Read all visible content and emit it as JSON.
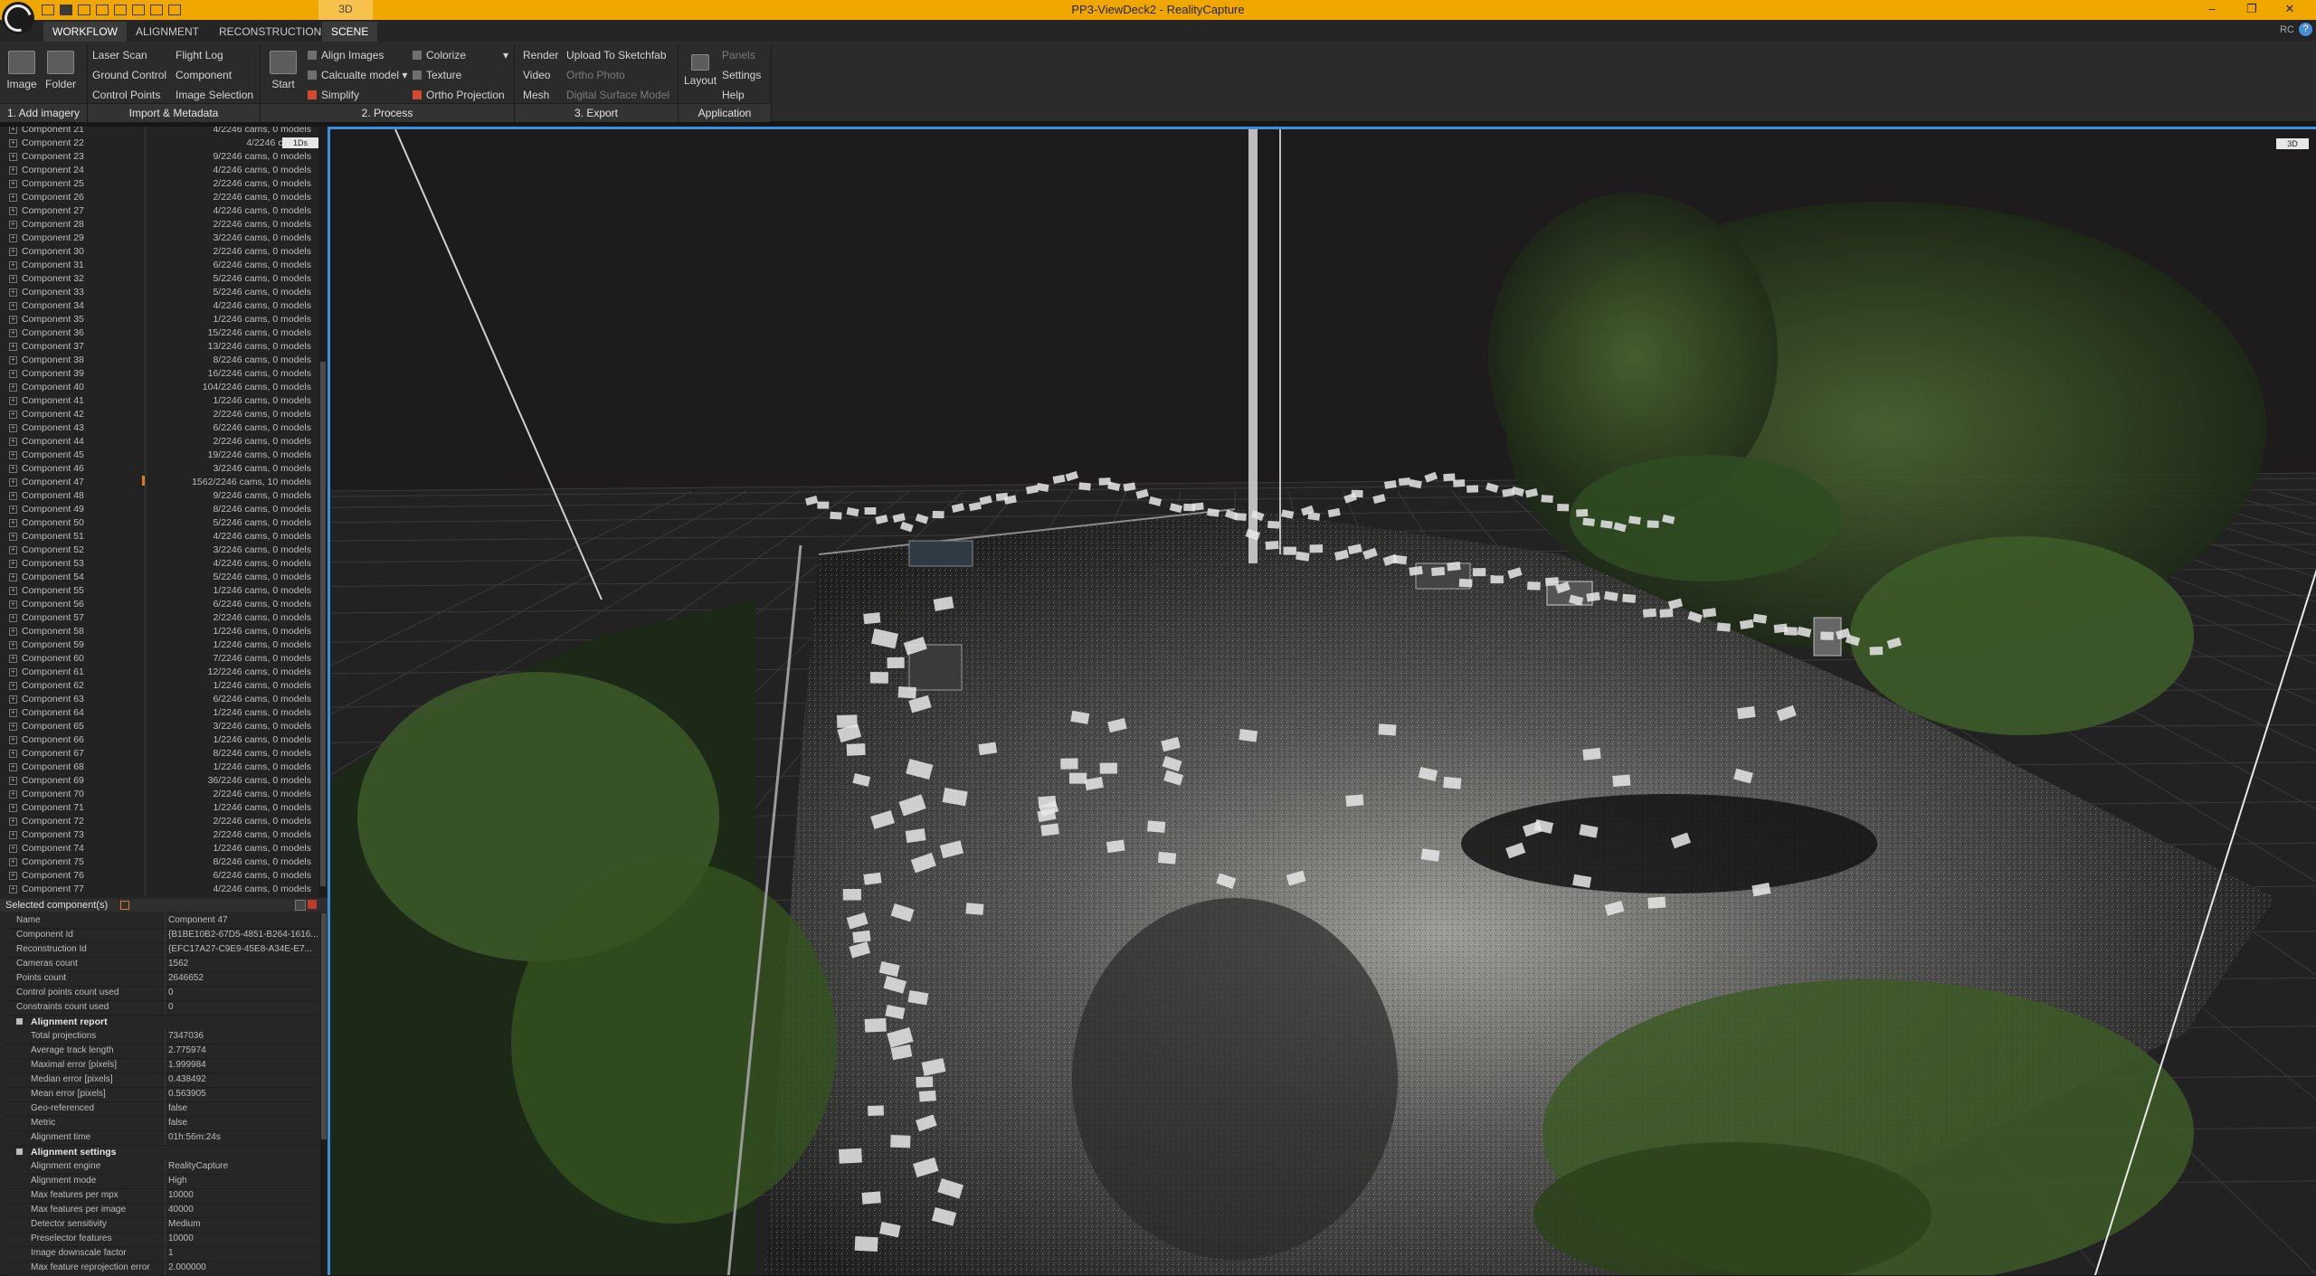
{
  "titlebar": {
    "title": "PP3-ViewDeck2 - RealityCapture",
    "mode_tab": "3D",
    "window_controls": [
      "–",
      "❐",
      "✕"
    ]
  },
  "menu": {
    "tabs": [
      "WORKFLOW",
      "ALIGNMENT",
      "RECONSTRUCTION",
      "SCENE"
    ],
    "active": "WORKFLOW",
    "rc_label": "RC",
    "help_label": "?"
  },
  "ribbon": {
    "add_imagery": {
      "image_label": "Image",
      "folder_label": "Folder",
      "group": "1. Add imagery"
    },
    "import": {
      "laser_scan": "Laser Scan",
      "ground_control": "Ground Control",
      "control_points": "Control Points",
      "flight_log": "Flight Log",
      "component": "Component",
      "image_selection": "Image Selection",
      "group": "Import & Metadata"
    },
    "process": {
      "start": "Start",
      "align_images": "Align Images",
      "calculate_model": "Calcualte model",
      "simplify": "Simplify",
      "colorize": "Colorize",
      "texture": "Texture",
      "ortho_projection": "Ortho Projection",
      "group": "2. Process"
    },
    "export": {
      "render": "Render",
      "video": "Video",
      "mesh": "Mesh",
      "upload": "Upload To Sketchfab",
      "ortho_photo": "Ortho Photo",
      "dsm": "Digital Surface Model",
      "group": "3. Export"
    },
    "application": {
      "layout": "Layout",
      "panels": "Panels",
      "settings": "Settings",
      "help": "Help",
      "group": "Application"
    }
  },
  "components": {
    "badge": "1Ds",
    "rows": [
      {
        "name": "Component 21",
        "status": "4/2246 cams, 0 models"
      },
      {
        "name": "Component 22",
        "status": "4/2246 cams, 0"
      },
      {
        "name": "Component 23",
        "status": "9/2246 cams, 0 models"
      },
      {
        "name": "Component 24",
        "status": "4/2246 cams, 0 models"
      },
      {
        "name": "Component 25",
        "status": "2/2246 cams, 0 models"
      },
      {
        "name": "Component 26",
        "status": "2/2246 cams, 0 models"
      },
      {
        "name": "Component 27",
        "status": "4/2246 cams, 0 models"
      },
      {
        "name": "Component 28",
        "status": "2/2246 cams, 0 models"
      },
      {
        "name": "Component 29",
        "status": "3/2246 cams, 0 models"
      },
      {
        "name": "Component 30",
        "status": "2/2246 cams, 0 models"
      },
      {
        "name": "Component 31",
        "status": "6/2246 cams, 0 models"
      },
      {
        "name": "Component 32",
        "status": "5/2246 cams, 0 models"
      },
      {
        "name": "Component 33",
        "status": "5/2246 cams, 0 models"
      },
      {
        "name": "Component 34",
        "status": "4/2246 cams, 0 models"
      },
      {
        "name": "Component 35",
        "status": "1/2246 cams, 0 models"
      },
      {
        "name": "Component 36",
        "status": "15/2246 cams, 0 models"
      },
      {
        "name": "Component 37",
        "status": "13/2246 cams, 0 models"
      },
      {
        "name": "Component 38",
        "status": "8/2246 cams, 0 models"
      },
      {
        "name": "Component 39",
        "status": "16/2246 cams, 0 models"
      },
      {
        "name": "Component 40",
        "status": "104/2246 cams, 0 models"
      },
      {
        "name": "Component 41",
        "status": "1/2246 cams, 0 models"
      },
      {
        "name": "Component 42",
        "status": "2/2246 cams, 0 models"
      },
      {
        "name": "Component 43",
        "status": "6/2246 cams, 0 models"
      },
      {
        "name": "Component 44",
        "status": "2/2246 cams, 0 models"
      },
      {
        "name": "Component 45",
        "status": "19/2246 cams, 0 models"
      },
      {
        "name": "Component 46",
        "status": "3/2246 cams, 0 models"
      },
      {
        "name": "Component 47",
        "status": "1562/2246 cams, 10 models"
      },
      {
        "name": "Component 48",
        "status": "9/2246 cams, 0 models"
      },
      {
        "name": "Component 49",
        "status": "8/2246 cams, 0 models"
      },
      {
        "name": "Component 50",
        "status": "5/2246 cams, 0 models"
      },
      {
        "name": "Component 51",
        "status": "4/2246 cams, 0 models"
      },
      {
        "name": "Component 52",
        "status": "3/2246 cams, 0 models"
      },
      {
        "name": "Component 53",
        "status": "4/2246 cams, 0 models"
      },
      {
        "name": "Component 54",
        "status": "5/2246 cams, 0 models"
      },
      {
        "name": "Component 55",
        "status": "1/2246 cams, 0 models"
      },
      {
        "name": "Component 56",
        "status": "6/2246 cams, 0 models"
      },
      {
        "name": "Component 57",
        "status": "2/2246 cams, 0 models"
      },
      {
        "name": "Component 58",
        "status": "1/2246 cams, 0 models"
      },
      {
        "name": "Component 59",
        "status": "1/2246 cams, 0 models"
      },
      {
        "name": "Component 60",
        "status": "7/2246 cams, 0 models"
      },
      {
        "name": "Component 61",
        "status": "12/2246 cams, 0 models"
      },
      {
        "name": "Component 62",
        "status": "1/2246 cams, 0 models"
      },
      {
        "name": "Component 63",
        "status": "6/2246 cams, 0 models"
      },
      {
        "name": "Component 64",
        "status": "1/2246 cams, 0 models"
      },
      {
        "name": "Component 65",
        "status": "3/2246 cams, 0 models"
      },
      {
        "name": "Component 66",
        "status": "1/2246 cams, 0 models"
      },
      {
        "name": "Component 67",
        "status": "8/2246 cams, 0 models"
      },
      {
        "name": "Component 68",
        "status": "1/2246 cams, 0 models"
      },
      {
        "name": "Component 69",
        "status": "36/2246 cams, 0 models"
      },
      {
        "name": "Component 70",
        "status": "2/2246 cams, 0 models"
      },
      {
        "name": "Component 71",
        "status": "1/2246 cams, 0 models"
      },
      {
        "name": "Component 72",
        "status": "2/2246 cams, 0 models"
      },
      {
        "name": "Component 73",
        "status": "2/2246 cams, 0 models"
      },
      {
        "name": "Component 74",
        "status": "1/2246 cams, 0 models"
      },
      {
        "name": "Component 75",
        "status": "8/2246 cams, 0 models"
      },
      {
        "name": "Component 76",
        "status": "6/2246 cams, 0 models"
      },
      {
        "name": "Component 77",
        "status": "4/2246 cams, 0 models"
      }
    ]
  },
  "selected": {
    "header": "Selected component(s)",
    "properties": [
      {
        "key": "Name",
        "value": "Component 47"
      },
      {
        "key": "Component Id",
        "value": "{B1BE10B2-67D5-4851-B264-1616..."
      },
      {
        "key": "Reconstruction Id",
        "value": "{EFC17A27-C9E9-45E8-A34E-E7..."
      },
      {
        "key": "Cameras count",
        "value": "1562"
      },
      {
        "key": "Points count",
        "value": "2646652"
      },
      {
        "key": "Control points count used",
        "value": "0"
      },
      {
        "key": "Constraints count used",
        "value": "0"
      }
    ],
    "alignment_report": {
      "title": "Alignment report",
      "properties": [
        {
          "key": "Total projections",
          "value": "7347036"
        },
        {
          "key": "Average track length",
          "value": "2.775974"
        },
        {
          "key": "Maximal error [pixels]",
          "value": "1.999984"
        },
        {
          "key": "Median error [pixels]",
          "value": "0.438492"
        },
        {
          "key": "Mean error [pixels]",
          "value": "0.563905"
        },
        {
          "key": "Geo-referenced",
          "value": "false"
        },
        {
          "key": "Metric",
          "value": "false"
        },
        {
          "key": "Alignment time",
          "value": "01h:56m:24s"
        }
      ]
    },
    "alignment_settings": {
      "title": "Alignment settings",
      "properties": [
        {
          "key": "Alignment engine",
          "value": "RealityCapture"
        },
        {
          "key": "Alignment mode",
          "value": "High"
        },
        {
          "key": "Max features per mpx",
          "value": "10000"
        },
        {
          "key": "Max features per image",
          "value": "40000"
        },
        {
          "key": "Detector sensitivity",
          "value": "Medium"
        },
        {
          "key": "Preselector features",
          "value": "10000"
        },
        {
          "key": "Image downscale factor",
          "value": "1"
        },
        {
          "key": "Max feature reprojection error",
          "value": "2.000000"
        }
      ]
    }
  },
  "viewport": {
    "tag": "3D"
  },
  "colors": {
    "titlebar": "#f0a800",
    "viewport_border": "#3b8fe0",
    "accent_orange": "#e07a1a"
  }
}
